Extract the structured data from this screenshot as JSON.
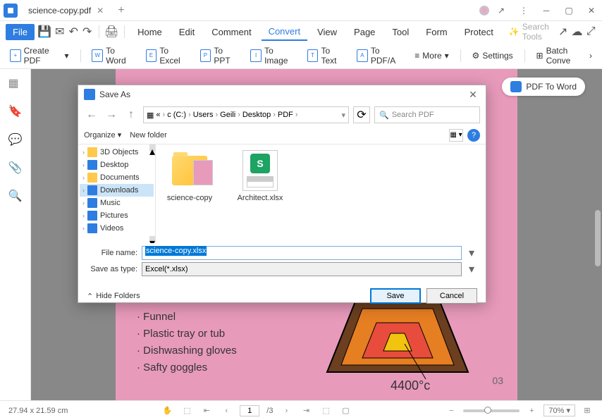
{
  "titlebar": {
    "tab_title": "science-copy.pdf"
  },
  "menubar": {
    "file": "File",
    "items": [
      "Home",
      "Edit",
      "Comment",
      "Convert",
      "View",
      "Page",
      "Tool",
      "Form",
      "Protect"
    ],
    "search_placeholder": "Search Tools"
  },
  "toolbar": {
    "create": "Create PDF",
    "to_word": "To Word",
    "to_excel": "To Excel",
    "to_ppt": "To PPT",
    "to_image": "To Image",
    "to_text": "To Text",
    "to_pdfa": "To PDF/A",
    "more": "More",
    "settings": "Settings",
    "batch": "Batch Conve"
  },
  "floating_btn": "PDF To Word",
  "document": {
    "bullets": [
      "Funnel",
      "Plastic tray or tub",
      "Dishwashing gloves",
      "Safty goggles"
    ],
    "temp": "4400°c",
    "page": "03"
  },
  "dialog": {
    "title": "Save As",
    "breadcrumb": [
      "«",
      "c (C:)",
      "Users",
      "Geili",
      "Desktop",
      "PDF"
    ],
    "search_placeholder": "Search PDF",
    "organize": "Organize",
    "new_folder": "New folder",
    "tree": [
      "3D Objects",
      "Desktop",
      "Documents",
      "Downloads",
      "Music",
      "Pictures",
      "Videos"
    ],
    "files": [
      {
        "name": "science-copy",
        "type": "folder"
      },
      {
        "name": "Architect.xlsx",
        "type": "xlsx"
      }
    ],
    "filename_label": "File name:",
    "filename_value": "science-copy.xlsx",
    "savetype_label": "Save as type:",
    "savetype_value": "Excel(*.xlsx)",
    "hide_folders": "Hide Folders",
    "save": "Save",
    "cancel": "Cancel"
  },
  "statusbar": {
    "dimensions": "27.94 x 21.59 cm",
    "page_current": "1",
    "page_total": "/3",
    "zoom": "70%"
  }
}
